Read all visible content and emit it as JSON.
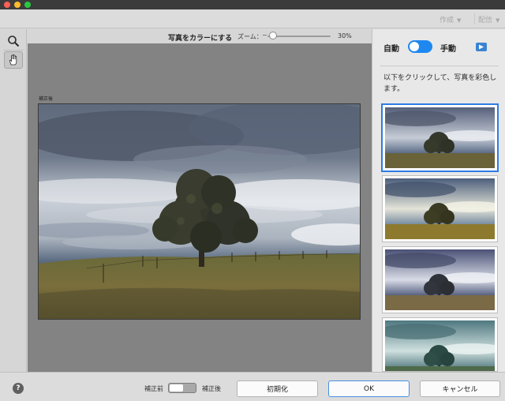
{
  "window": {
    "title": ""
  },
  "menubar": {
    "create_label": "作成",
    "share_label": "配信"
  },
  "toolbar": {
    "title": "写真をカラーにする",
    "zoom_label": "ズーム：",
    "zoom_minus": "−",
    "zoom_value": "30%",
    "zoom_level": 0.05
  },
  "canvas": {
    "after_label": "補正後"
  },
  "tools": [
    {
      "name": "zoom",
      "icon": "magnifier-icon"
    },
    {
      "name": "hand",
      "icon": "hand-icon",
      "selected": true
    }
  ],
  "panel": {
    "auto_label": "自動",
    "manual_label": "手動",
    "mode": "auto",
    "instruction": "以下をクリックして、写真を彩色します。",
    "thumbnails": [
      {
        "variant": "natural",
        "selected": true
      },
      {
        "variant": "warm",
        "selected": false
      },
      {
        "variant": "cool",
        "selected": false
      },
      {
        "variant": "teal",
        "selected": false
      }
    ]
  },
  "bottom": {
    "help_label": "?",
    "before_label": "補正前",
    "after_label": "補正後",
    "reset_label": "初期化",
    "ok_label": "OK",
    "cancel_label": "キャンセル"
  },
  "colors": {
    "accent": "#1e88f0",
    "canvas_bg": "#838383",
    "ok_border": "#4a90e2"
  }
}
